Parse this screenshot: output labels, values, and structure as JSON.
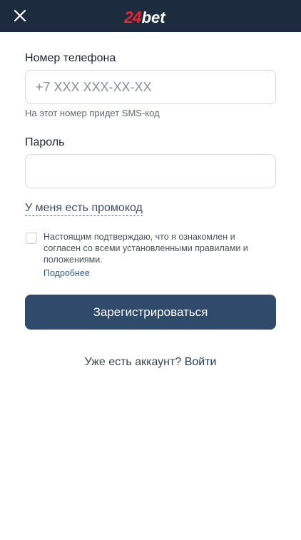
{
  "header": {
    "logo_number": "24",
    "logo_word": "bet",
    "brand_color": "#e8242c",
    "background_color": "#1c2b3d"
  },
  "form": {
    "phone_label": "Номер телефона",
    "phone_placeholder": "+7 XXX XXX-XX-XX",
    "phone_value": "",
    "phone_hint": "На этот номер придет SMS-код",
    "password_label": "Пароль",
    "password_value": "",
    "promo_link": "У меня есть промокод",
    "consent_checked": false,
    "consent_text": "Настоящим подтверждаю, что я ознакомлен и согласен со всеми установленными правилами и положениями.",
    "consent_more_link": "Подробнее",
    "register_button": "Зарегистрироваться",
    "button_color": "#2f4a6b"
  },
  "footer": {
    "login_prompt": "Уже есть аккаунт?",
    "login_link": "Войти"
  }
}
